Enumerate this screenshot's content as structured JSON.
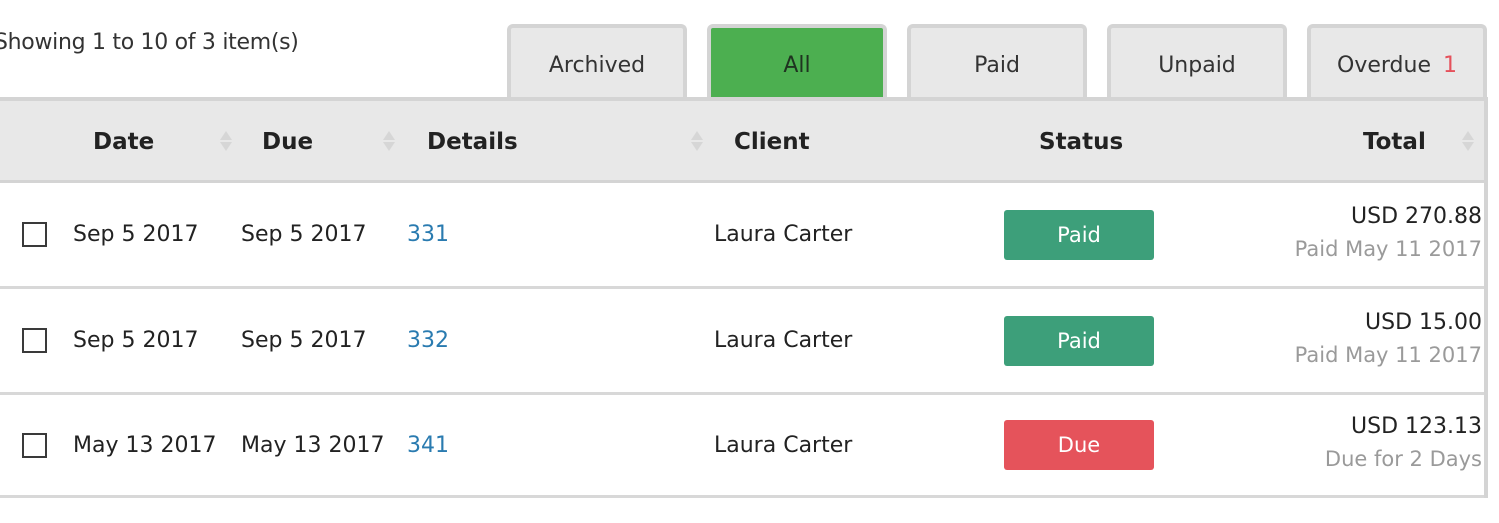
{
  "pagination": {
    "summary": "Showing 1 to 10 of 3 item(s)"
  },
  "tabs": [
    {
      "label": "Archived",
      "active": false,
      "badge": ""
    },
    {
      "label": "All",
      "active": true,
      "badge": ""
    },
    {
      "label": "Paid",
      "active": false,
      "badge": ""
    },
    {
      "label": "Unpaid",
      "active": false,
      "badge": ""
    },
    {
      "label": "Overdue",
      "active": false,
      "badge": "1"
    }
  ],
  "colors": {
    "active_tab": "#4caf50",
    "paid": "#3d9f7a",
    "due": "#e5535b",
    "link": "#2a7bb0",
    "overdue_badge": "#e5515b"
  },
  "table": {
    "columns": [
      {
        "key": "date",
        "label": "Date",
        "sortable": true
      },
      {
        "key": "due",
        "label": "Due",
        "sortable": true
      },
      {
        "key": "details",
        "label": "Details",
        "sortable": true
      },
      {
        "key": "client",
        "label": "Client",
        "sortable": false
      },
      {
        "key": "status",
        "label": "Status",
        "sortable": false
      },
      {
        "key": "total",
        "label": "Total",
        "sortable": true
      }
    ],
    "rows": [
      {
        "checked": false,
        "date": "Sep 5 2017",
        "due": "Sep 5 2017",
        "details": "331",
        "client": "Laura Carter",
        "status": "Paid",
        "status_type": "paid",
        "total": "USD 270.88",
        "total_sub": "Paid May 11 2017"
      },
      {
        "checked": false,
        "date": "Sep 5 2017",
        "due": "Sep 5 2017",
        "details": "332",
        "client": "Laura Carter",
        "status": "Paid",
        "status_type": "paid",
        "total": "USD 15.00",
        "total_sub": "Paid May 11 2017"
      },
      {
        "checked": false,
        "date": "May 13 2017",
        "due": "May 13 2017",
        "details": "341",
        "client": "Laura Carter",
        "status": "Due",
        "status_type": "due",
        "total": "USD 123.13",
        "total_sub": "Due for 2 Days"
      }
    ]
  }
}
